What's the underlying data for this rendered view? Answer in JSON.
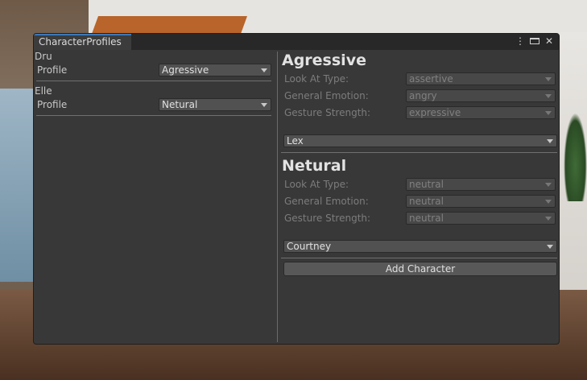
{
  "window": {
    "tab_title": "CharacterProfiles"
  },
  "left": {
    "characters": [
      {
        "name": "Dru",
        "profile_label": "Profile",
        "profile_value": "Agressive"
      },
      {
        "name": "Elle",
        "profile_label": "Profile",
        "profile_value": "Netural"
      }
    ]
  },
  "right": {
    "profiles": [
      {
        "title": "Agressive",
        "look_label": "Look At Type:",
        "look_value": "assertive",
        "emotion_label": "General Emotion:",
        "emotion_value": "angry",
        "gesture_label": "Gesture Strength:",
        "gesture_value": "expressive",
        "character_select": "Lex"
      },
      {
        "title": "Netural",
        "look_label": "Look At Type:",
        "look_value": "neutral",
        "emotion_label": "General Emotion:",
        "emotion_value": "neutral",
        "gesture_label": "Gesture Strength:",
        "gesture_value": "neutral",
        "character_select": "Courtney"
      }
    ],
    "add_button": "Add Character"
  },
  "icons": [
    "menu-kebab-icon",
    "maximize-icon",
    "close-icon"
  ]
}
